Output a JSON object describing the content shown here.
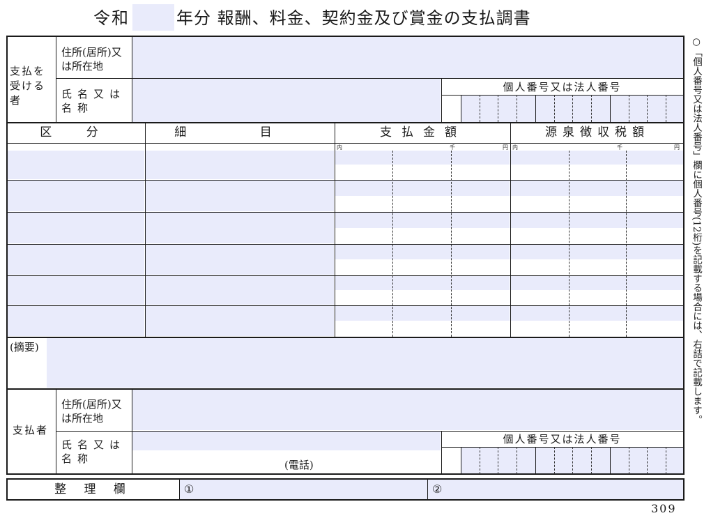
{
  "title": {
    "era": "令和",
    "year_value": "",
    "rest": "年分 報酬、料金、契約金及び賞金の支払調書"
  },
  "payee": {
    "section_label": "支払を受ける者",
    "address_label": "住所(居所)又は所在地",
    "address_value": "",
    "name_label": "氏名又は名称",
    "name_value": "",
    "number_label": "個人番号又は法人番号"
  },
  "table": {
    "headers": [
      "区 分",
      "細 目",
      "支払金額",
      "源泉徴収税額"
    ],
    "unit_marks": [
      "内",
      "千",
      "円"
    ],
    "rows": [
      {
        "category": "",
        "detail": "",
        "amount": "",
        "tax": ""
      },
      {
        "category": "",
        "detail": "",
        "amount": "",
        "tax": ""
      },
      {
        "category": "",
        "detail": "",
        "amount": "",
        "tax": ""
      },
      {
        "category": "",
        "detail": "",
        "amount": "",
        "tax": ""
      },
      {
        "category": "",
        "detail": "",
        "amount": "",
        "tax": ""
      },
      {
        "category": "",
        "detail": "",
        "amount": "",
        "tax": ""
      }
    ]
  },
  "summary": {
    "label": "(摘要)",
    "value": ""
  },
  "payer": {
    "section_label": "支払者",
    "address_label": "住所(居所)又は所在地",
    "address_value": "",
    "name_label": "氏名又は名称",
    "name_value": "",
    "phone_label": "(電話)",
    "number_label": "個人番号又は法人番号"
  },
  "admin": {
    "label": "整 理 欄",
    "field1_mark": "①",
    "field1_value": "",
    "field2_mark": "②",
    "field2_value": ""
  },
  "side_note": "○「個人番号又は法人番号」欄に個人番号(12桁)を記載する場合には、右詰で記載します。",
  "form_code": "309"
}
